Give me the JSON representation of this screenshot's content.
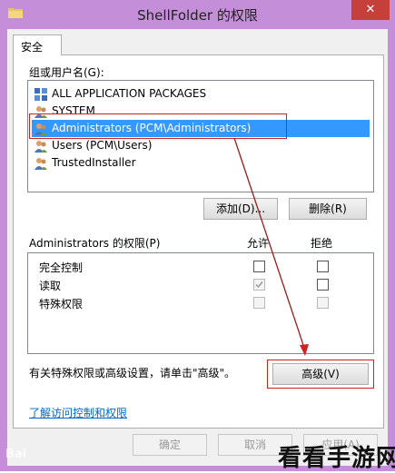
{
  "window": {
    "title": "ShellFolder 的权限",
    "close_glyph": "✕"
  },
  "tab": {
    "label": "安全"
  },
  "groups": {
    "label": "组或用户名(G):",
    "items": [
      {
        "label": "ALL APPLICATION PACKAGES",
        "icon": "packages-icon"
      },
      {
        "label": "SYSTEM",
        "icon": "users-icon"
      },
      {
        "label": "Administrators (PCM\\Administrators)",
        "icon": "users-icon",
        "selected": true
      },
      {
        "label": "Users (PCM\\Users)",
        "icon": "users-icon"
      },
      {
        "label": "TrustedInstaller",
        "icon": "users-icon"
      }
    ]
  },
  "buttons": {
    "add": "添加(D)...",
    "remove": "删除(R)",
    "advanced": "高级(V)",
    "ok": "确定",
    "cancel": "取消",
    "apply": "应用(A)"
  },
  "permissions": {
    "label": "Administrators 的权限(P)",
    "allow_header": "允许",
    "deny_header": "拒绝",
    "rows": [
      {
        "name": "完全控制",
        "allow": false,
        "deny": false,
        "dim": false
      },
      {
        "name": "读取",
        "allow": true,
        "deny": false,
        "dim": true
      },
      {
        "name": "特殊权限",
        "allow": false,
        "deny": false,
        "dim": true
      }
    ]
  },
  "advanced_hint": "有关特殊权限或高级设置，请单击\"高级\"。",
  "link": "了解访问控制和权限",
  "watermarks": {
    "left": "Bai",
    "right": "看看手游网"
  },
  "colors": {
    "accent": "#c48ed9",
    "selection": "#3399ff",
    "annotation": "#d02020",
    "close": "#c5403a"
  }
}
